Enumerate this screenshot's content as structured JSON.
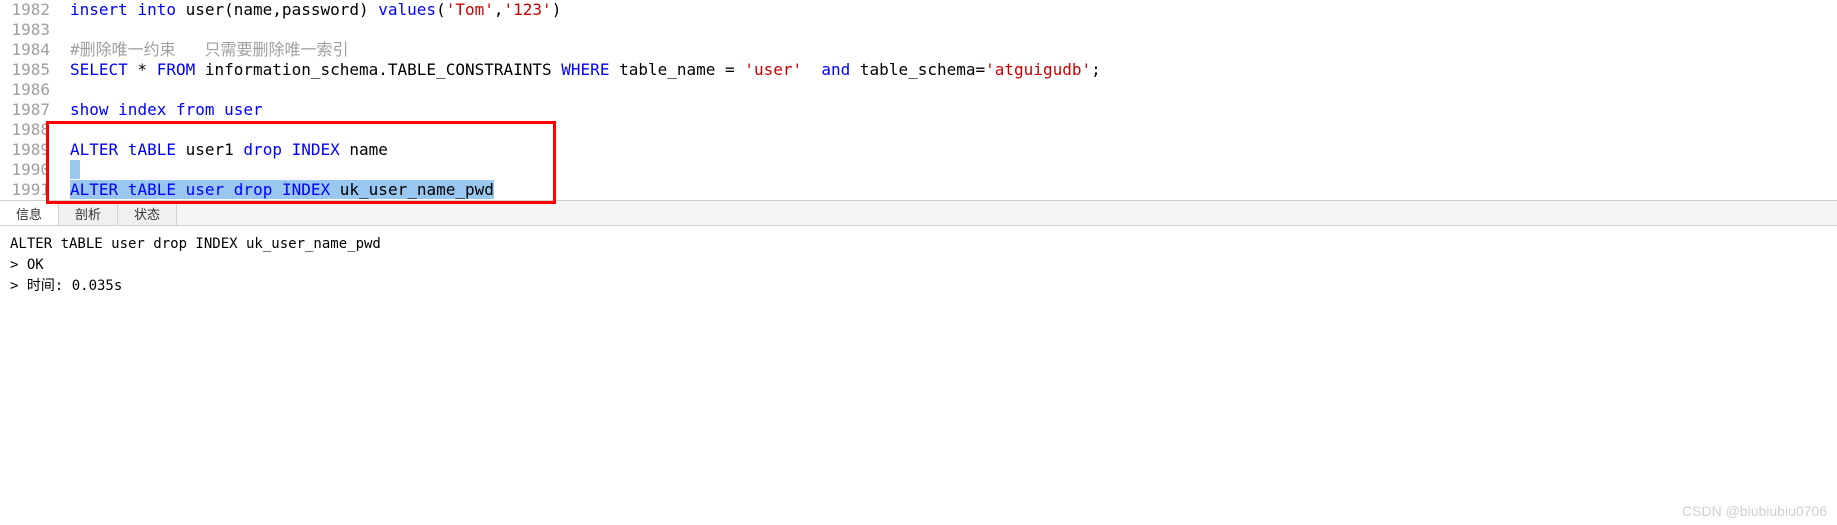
{
  "editor": {
    "lines": [
      {
        "num": "1982",
        "tokens": [
          {
            "t": "insert",
            "c": "kw"
          },
          {
            "t": " ",
            "c": "id"
          },
          {
            "t": "into",
            "c": "kw"
          },
          {
            "t": " user(name,password) ",
            "c": "id"
          },
          {
            "t": "values",
            "c": "kw"
          },
          {
            "t": "(",
            "c": "punc"
          },
          {
            "t": "'Tom'",
            "c": "str"
          },
          {
            "t": ",",
            "c": "punc"
          },
          {
            "t": "'123'",
            "c": "str"
          },
          {
            "t": ")",
            "c": "punc"
          }
        ]
      },
      {
        "num": "1983",
        "tokens": []
      },
      {
        "num": "1984",
        "tokens": [
          {
            "t": "#删除唯一约束   只需要删除唯一索引",
            "c": "cm"
          }
        ]
      },
      {
        "num": "1985",
        "tokens": [
          {
            "t": "SELECT",
            "c": "kw"
          },
          {
            "t": " * ",
            "c": "id"
          },
          {
            "t": "FROM",
            "c": "kw"
          },
          {
            "t": " information_schema.TABLE_CONSTRAINTS ",
            "c": "id"
          },
          {
            "t": "WHERE",
            "c": "kw"
          },
          {
            "t": " table_name = ",
            "c": "id"
          },
          {
            "t": "'user'",
            "c": "str"
          },
          {
            "t": "  ",
            "c": "id"
          },
          {
            "t": "and",
            "c": "kw"
          },
          {
            "t": " table_schema=",
            "c": "id"
          },
          {
            "t": "'atguigudb'",
            "c": "str"
          },
          {
            "t": ";",
            "c": "punc"
          }
        ]
      },
      {
        "num": "1986",
        "tokens": []
      },
      {
        "num": "1987",
        "tokens": [
          {
            "t": "show",
            "c": "kw"
          },
          {
            "t": " ",
            "c": "id"
          },
          {
            "t": "index",
            "c": "kw"
          },
          {
            "t": " ",
            "c": "id"
          },
          {
            "t": "from",
            "c": "kw"
          },
          {
            "t": " ",
            "c": "id"
          },
          {
            "t": "user",
            "c": "kw"
          }
        ]
      },
      {
        "num": "1988",
        "tokens": []
      },
      {
        "num": "1989",
        "tokens": [
          {
            "t": "ALTER",
            "c": "kw"
          },
          {
            "t": " ",
            "c": "id"
          },
          {
            "t": "tABLE",
            "c": "kw"
          },
          {
            "t": " user1 ",
            "c": "id"
          },
          {
            "t": "drop",
            "c": "kw"
          },
          {
            "t": " ",
            "c": "id"
          },
          {
            "t": "INDEX",
            "c": "kw"
          },
          {
            "t": " name",
            "c": "id"
          }
        ]
      },
      {
        "num": "1990",
        "tokens": [
          {
            "t": " ",
            "c": "id",
            "sel": true
          }
        ]
      },
      {
        "num": "1991",
        "tokens": [
          {
            "t": "ALTER",
            "c": "kw",
            "sel": true
          },
          {
            "t": " ",
            "c": "id",
            "sel": true
          },
          {
            "t": "tABLE",
            "c": "kw",
            "sel": true
          },
          {
            "t": " ",
            "c": "id",
            "sel": true
          },
          {
            "t": "user",
            "c": "kw",
            "sel": true
          },
          {
            "t": " ",
            "c": "id",
            "sel": true
          },
          {
            "t": "drop",
            "c": "kw",
            "sel": true
          },
          {
            "t": " ",
            "c": "id",
            "sel": true
          },
          {
            "t": "INDEX",
            "c": "kw",
            "sel": true
          },
          {
            "t": " uk_user_name_pwd",
            "c": "id",
            "sel": true
          }
        ]
      }
    ]
  },
  "tabs": {
    "items": [
      "信息",
      "剖析",
      "状态"
    ],
    "active_index": 0
  },
  "output": {
    "lines": [
      "ALTER tABLE user drop INDEX uk_user_name_pwd",
      "> OK",
      "> 时间: 0.035s"
    ]
  },
  "watermark": "CSDN @biubiubiu0706"
}
